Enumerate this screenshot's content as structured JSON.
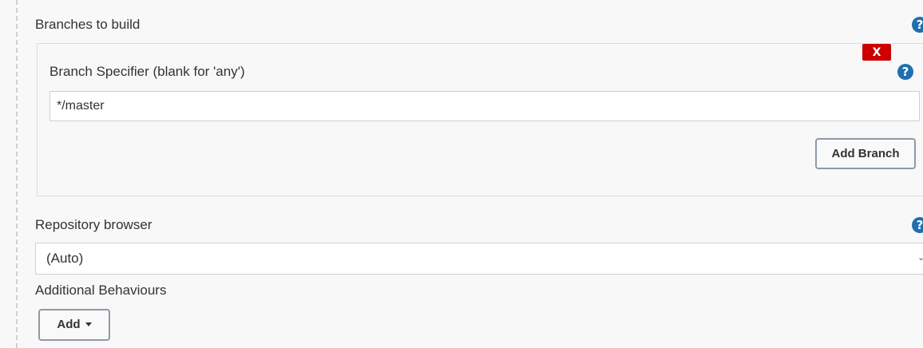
{
  "branches_to_build": {
    "label": "Branches to build",
    "help_icon": "?",
    "branch": {
      "delete_label": "X",
      "specifier_label": "Branch Specifier (blank for 'any')",
      "help_icon": "?",
      "specifier_value": "*/master"
    },
    "add_branch_label": "Add Branch"
  },
  "repository_browser": {
    "label": "Repository browser",
    "help_icon": "?",
    "selected": "(Auto)"
  },
  "additional_behaviours": {
    "label": "Additional Behaviours",
    "add_label": "Add"
  },
  "colors": {
    "help_icon": "#1e6fb0",
    "delete_button": "#cc0000",
    "page_background": "#f8f8f8"
  },
  "icons": [
    "help-icon",
    "delete-icon",
    "chevron-down-icon",
    "caret-down-icon"
  ]
}
